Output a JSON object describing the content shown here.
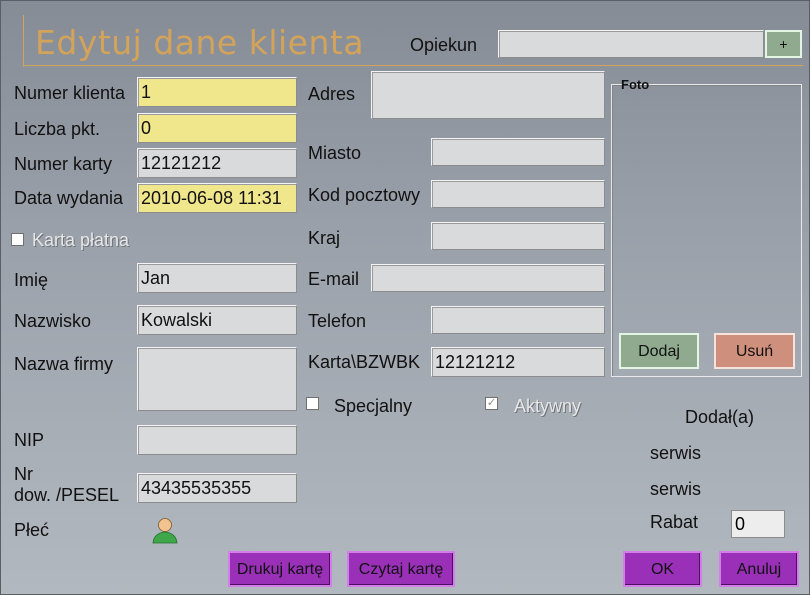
{
  "header": {
    "title": "Edytuj dane klienta"
  },
  "opiekun": {
    "label": "Opiekun",
    "value": "",
    "add_label": "+"
  },
  "left": {
    "numer_klienta": {
      "label": "Numer klienta",
      "value": "1"
    },
    "liczba_pkt": {
      "label": "Liczba pkt.",
      "value": "0"
    },
    "numer_karty": {
      "label": "Numer karty",
      "value": "12121212"
    },
    "data_wydania": {
      "label": "Data wydania",
      "value": "2010-06-08 11:31"
    },
    "karta_platna": {
      "label": "Karta płatna",
      "checked": false
    },
    "imie": {
      "label": "Imię",
      "value": "Jan"
    },
    "nazwisko": {
      "label": "Nazwisko",
      "value": "Kowalski"
    },
    "nazwa_firmy": {
      "label": "Nazwa firmy",
      "value": ""
    },
    "nip": {
      "label": "NIP",
      "value": ""
    },
    "nr_dow_line1": "Nr",
    "nr_dow_line2": "dow. /PESEL",
    "nr_dow_value": "43435535355",
    "plec": {
      "label": "Płeć",
      "icon": "person-icon"
    }
  },
  "middle": {
    "adres": {
      "label": "Adres",
      "value": ""
    },
    "miasto": {
      "label": "Miasto",
      "value": ""
    },
    "kod_pocztowy": {
      "label": "Kod pocztowy",
      "value": ""
    },
    "kraj": {
      "label": "Kraj",
      "value": ""
    },
    "email": {
      "label": "E-mail",
      "value": ""
    },
    "telefon": {
      "label": "Telefon",
      "value": ""
    },
    "karta_bzwbk": {
      "label": "Karta\\BZWBK",
      "value": "12121212"
    },
    "specjalny": {
      "label": "Specjalny",
      "checked": false
    },
    "aktywny": {
      "label": "Aktywny",
      "checked": true,
      "check_mark": "✓"
    }
  },
  "foto": {
    "label": "Foto",
    "add_button": "Dodaj",
    "remove_button": "Usuń"
  },
  "meta": {
    "dodal_label": "Dodał(a)",
    "user1": "serwis",
    "user2": "serwis",
    "rabat_label": "Rabat",
    "rabat_value": "0"
  },
  "buttons": {
    "print_card": "Drukuj kartę",
    "read_card": "Czytaj kartę",
    "ok": "OK",
    "cancel": "Anuluj"
  },
  "colors": {
    "title": "#d4a35a",
    "yellow_field": "#f0e68c",
    "purple_button": "#9a2fb8",
    "green_button": "#8faa8f",
    "salmon_button": "#cf8f7d"
  }
}
